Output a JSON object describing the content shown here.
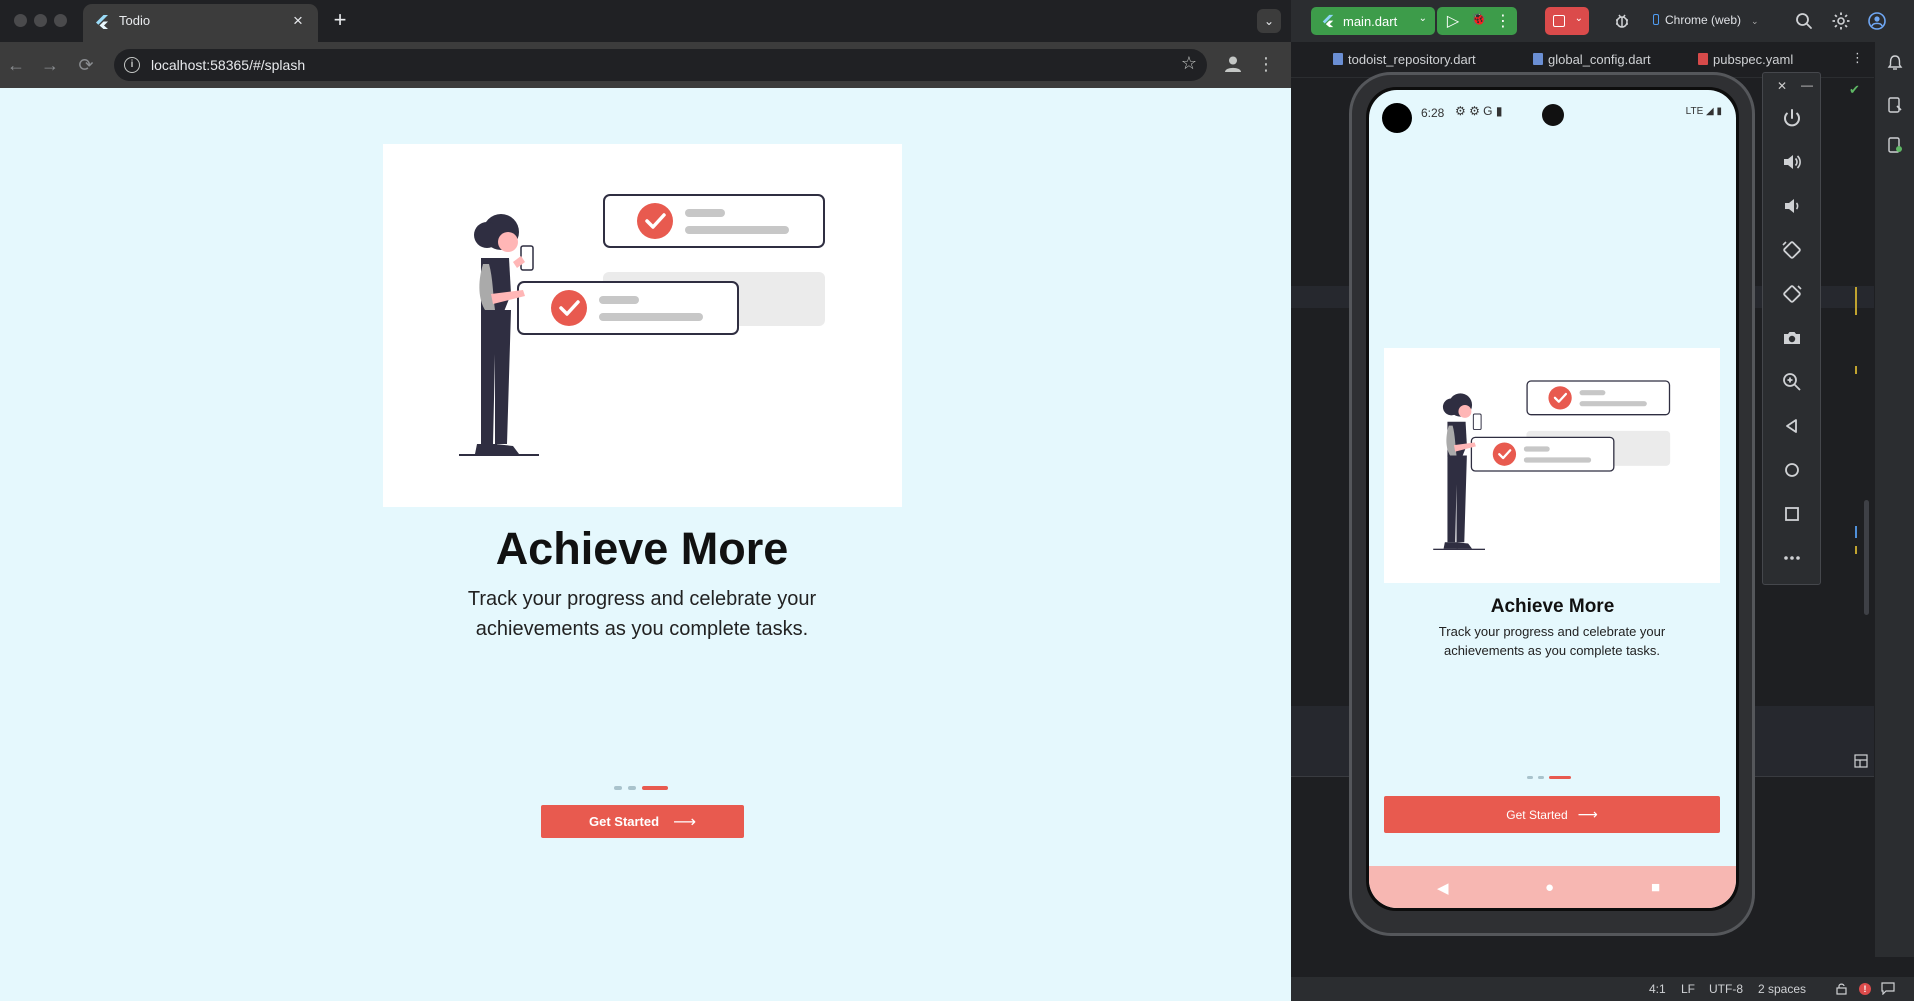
{
  "browser": {
    "tab": {
      "title": "Todio",
      "close_label": "×"
    },
    "new_tab_label": "+",
    "tab_search_label": "⌄",
    "toolbar": {
      "back_label": "←",
      "forward_label": "→",
      "reload_label": "⟳",
      "url": "localhost:58365/#/splash",
      "info_label": "i",
      "bookmark_label": "☆",
      "menu_label": "⋮"
    }
  },
  "app": {
    "title": "Achieve More",
    "subtitle": "Track your progress and celebrate your achievements as you complete tasks.",
    "cta_label": "Get Started",
    "cta_arrow": "⟶",
    "page_indicator": {
      "count": 3,
      "active_index": 2
    },
    "colors": {
      "background": "#e5f8fd",
      "accent": "#e85a4f",
      "dot_inactive": "#a9c3cc",
      "illustration_dark": "#2f2e41",
      "illustration_gray": "#ebebeb"
    }
  },
  "ide": {
    "run_config": {
      "label": "main.dart",
      "chevron": "⌄"
    },
    "run_icons": {
      "run": "▷",
      "debug": "🐞",
      "more": "⋮"
    },
    "stop_chevron": "⌄",
    "device": {
      "label": "Chrome (web)",
      "chevron": "⌄"
    },
    "file_tabs": [
      {
        "label": "todoist_repository.dart",
        "icon_color": "#6b8fd4"
      },
      {
        "label": "global_config.dart",
        "icon_color": "#6b8fd4"
      },
      {
        "label": "pubspec.yaml",
        "icon_color": "#d74a4a"
      }
    ],
    "tabs_menu_label": "⋮",
    "check_label": "✔",
    "status_bar": {
      "position": "4:1",
      "line_ending": "LF",
      "encoding": "UTF-8",
      "indent": "2 spaces",
      "error_label": "!"
    }
  },
  "emulator": {
    "status": {
      "time": "6:28",
      "icons": "⚙ ⚙ G ▮",
      "network": "LTE ◢ ▮"
    },
    "title": "Achieve More",
    "subtitle": "Track your progress and celebrate your achievements as you complete tasks.",
    "cta_label": "Get Started",
    "cta_arrow": "⟶",
    "nav": {
      "back": "◀",
      "home": "●",
      "recents": "■"
    },
    "panel": {
      "close_label": "✕",
      "minimize_label": "—"
    }
  }
}
